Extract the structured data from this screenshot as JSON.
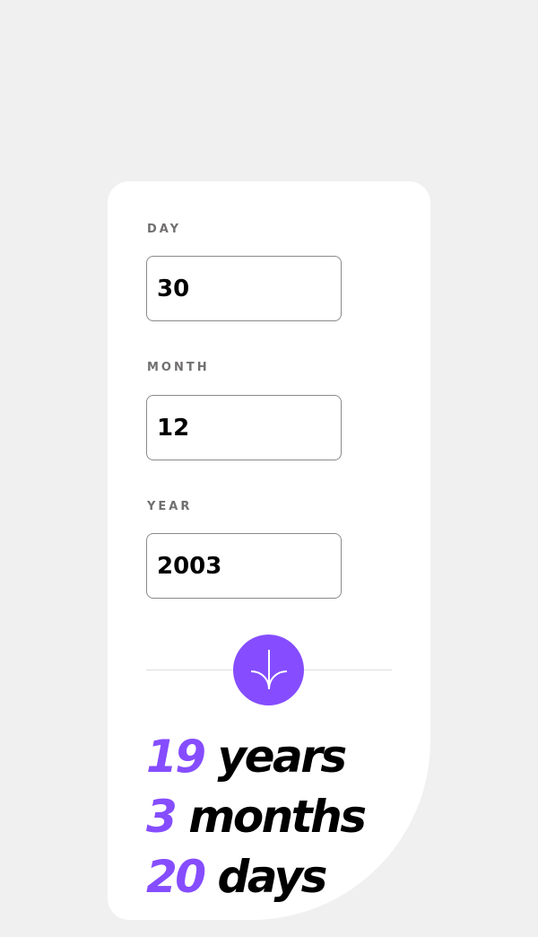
{
  "form": {
    "day": {
      "label": "DAY",
      "value": "30"
    },
    "month": {
      "label": "MONTH",
      "value": "12"
    },
    "year": {
      "label": "YEAR",
      "value": "2003"
    }
  },
  "submit": {
    "icon": "arrow-down-icon",
    "accent": "#854dff"
  },
  "result": {
    "years": {
      "value": "19",
      "unit": "years"
    },
    "months": {
      "value": "3",
      "unit": "months"
    },
    "days": {
      "value": "20",
      "unit": "days"
    }
  },
  "colors": {
    "accent": "#854dff",
    "background": "#f0f0f0",
    "card": "#ffffff",
    "label": "#716f6f"
  }
}
